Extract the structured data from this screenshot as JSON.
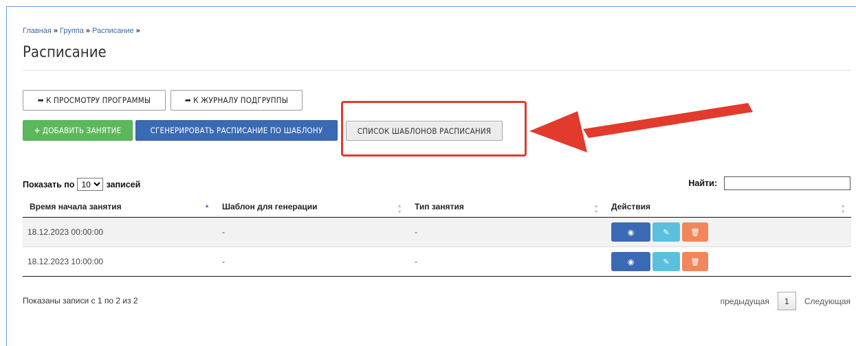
{
  "breadcrumb": {
    "home": "Главная",
    "group": "Группа",
    "schedule": "Расписание",
    "separator": "»"
  },
  "page_title": "Расписание",
  "buttons": {
    "view_program": "К ПРОСМОТРУ ПРОГРАММЫ",
    "subgroup_journal": "К ЖУРНАЛУ ПОДГРУППЫ",
    "add_lesson": "ДОБАВИТЬ ЗАНЯТИЕ",
    "generate_schedule": "СГЕНЕРИРОВАТЬ РАСПИСАНИЕ ПО ШАБЛОНУ",
    "template_list": "СПИСОК ШАБЛОНОВ РАСПИСАНИЯ"
  },
  "icons": {
    "share": "share-arrow-icon",
    "plus": "plus-icon",
    "view": "eye-icon",
    "edit": "pencil-icon",
    "delete": "trash-icon"
  },
  "annotation": {
    "color": "#e23a2c"
  },
  "table_controls": {
    "show_prefix": "Показать по",
    "page_size": "10",
    "page_size_options": [
      "10"
    ],
    "show_suffix": "записей",
    "search_label": "Найти:",
    "search_value": ""
  },
  "table": {
    "columns": [
      "Время начала занятия",
      "Шаблон для генерации",
      "Тип занятия",
      "Действия"
    ],
    "rows": [
      {
        "start_time": "18.12.2023 00:00:00",
        "template": "-",
        "type": "-"
      },
      {
        "start_time": "18.12.2023 10:00:00",
        "template": "-",
        "type": "-"
      }
    ]
  },
  "footer": {
    "info": "Показаны записи с 1 по 2 из 2",
    "prev": "предыдущая",
    "page": "1",
    "next": "Следующая"
  },
  "colors": {
    "primary": "#3b6ab4",
    "success": "#5cb85c",
    "info": "#5bc0de",
    "danger": "#f0865a"
  }
}
